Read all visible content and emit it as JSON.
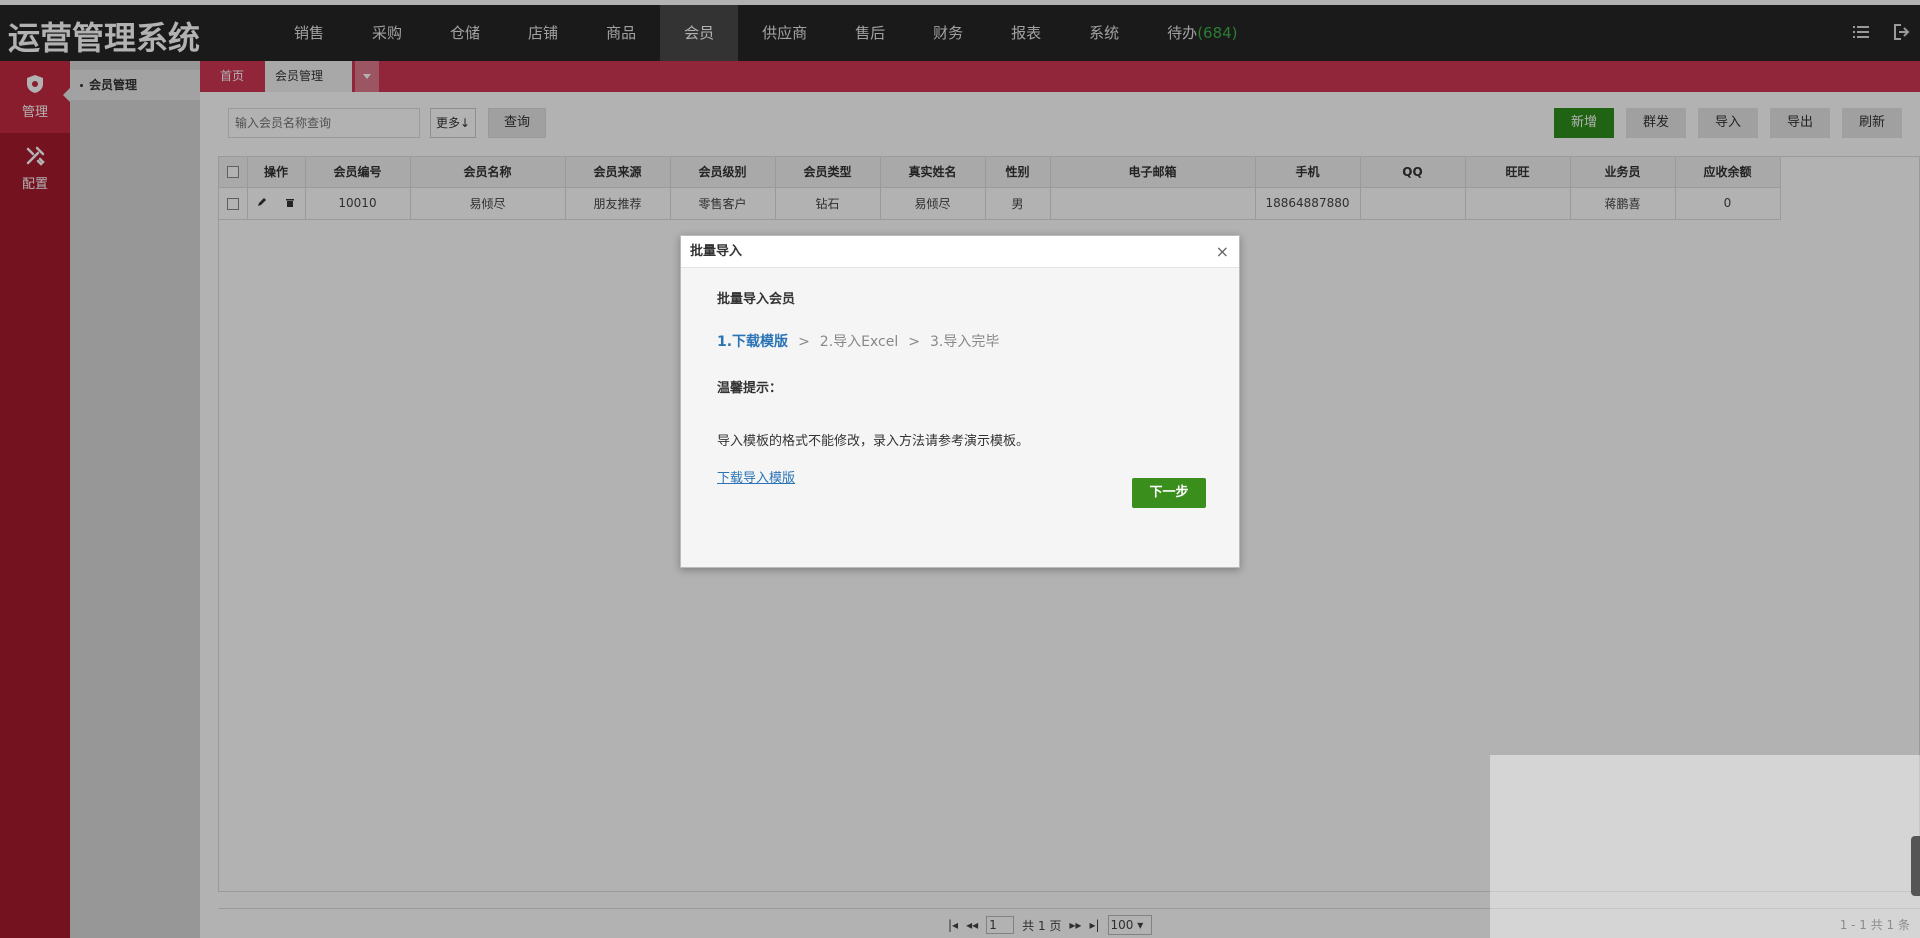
{
  "app": {
    "title": "运营管理系统"
  },
  "nav": {
    "items": [
      "销售",
      "采购",
      "仓储",
      "店铺",
      "商品",
      "会员",
      "供应商",
      "售后",
      "财务",
      "报表",
      "系统"
    ],
    "todo_label": "待办",
    "todo_count": "(684)"
  },
  "rail": {
    "items": [
      "管理",
      "配置"
    ]
  },
  "subside": {
    "item": "会员管理"
  },
  "tabs": {
    "home": "首页",
    "current": "会员管理",
    "close": "×"
  },
  "search": {
    "placeholder": "输入会员名称查询",
    "more_label": "更多↓",
    "query_label": "查询"
  },
  "toolbar": {
    "add": "新增",
    "mass_send": "群发",
    "import": "导入",
    "export": "导出",
    "refresh": "刷新"
  },
  "table": {
    "columns": [
      "操作",
      "会员编号",
      "会员名称",
      "会员来源",
      "会员级别",
      "会员类型",
      "真实姓名",
      "性别",
      "电子邮箱",
      "手机",
      "QQ",
      "旺旺",
      "业务员",
      "应收余额"
    ],
    "rows": [
      {
        "id": "10010",
        "name": "易倾尽",
        "source": "朋友推荐",
        "level": "零售客户",
        "type": "钻石",
        "real_name": "易倾尽",
        "gender": "男",
        "email": "",
        "phone": "18864887880",
        "qq": "",
        "wangwang": "",
        "salesman": "蒋鹏喜",
        "balance": "0"
      }
    ]
  },
  "pager": {
    "page": "1",
    "total_pages": "共 1 页",
    "page_size": "100",
    "summary": "1 - 1  共 1 条"
  },
  "modal": {
    "title": "批量导入",
    "close": "×",
    "heading": "批量导入会员",
    "step1": "1.下载模版",
    "step2": "2.导入Excel",
    "step3": "3.导入完毕",
    "sep": ">",
    "tip_title": "温馨提示：",
    "tip_text": "导入模板的格式不能修改，录入方法请参考演示模板。",
    "download_link": "下载导入模版",
    "next_button": "下一步"
  },
  "colors": {
    "topbar": "#262626",
    "rail": "#a81a2e",
    "tabbar": "#d03553",
    "primary": "#2f8f1c",
    "link": "#2a74b5",
    "todo": "#3cb34a"
  }
}
